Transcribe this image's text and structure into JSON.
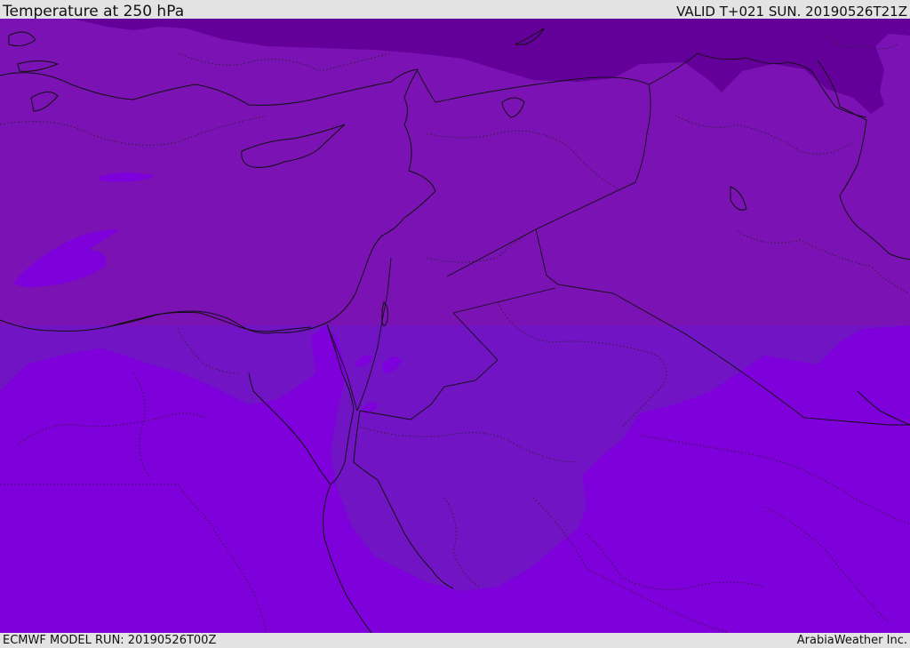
{
  "header": {
    "title": "Temperature at 250 hPa",
    "valid": "VALID T+021 SUN. 20190526T21Z"
  },
  "footer": {
    "model_run": "ECMWF MODEL RUN: 20190526T00Z",
    "credit": "ArabiaWeather Inc."
  },
  "map": {
    "colors": {
      "coldest_band": "#64009a",
      "cold_band": "#7a12b4",
      "mid_band": "#7014c4",
      "warm_band": "#7e00da",
      "land_outline": "#101010"
    }
  }
}
